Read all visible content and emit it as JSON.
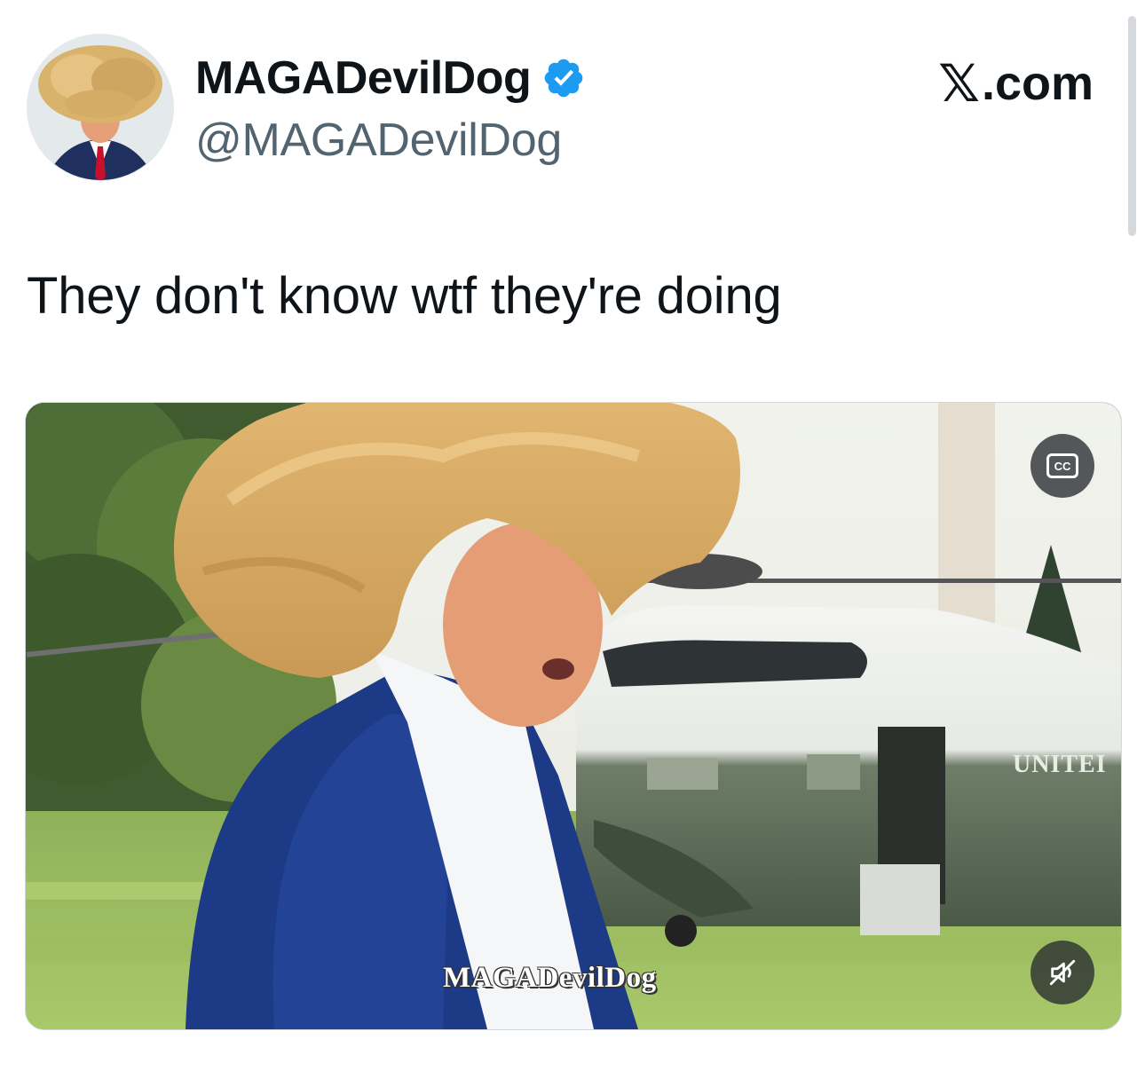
{
  "header": {
    "display_name": "MAGADevilDog",
    "handle": "@MAGADevilDog",
    "brand": ".com",
    "brand_glyph": "𝕏",
    "verified_color": "#1d9bf0"
  },
  "tweet": {
    "text": "They don't know wtf they're doing"
  },
  "media": {
    "watermark": "MAGADevilDog",
    "helicopter_text": "UNITEI",
    "cc_label": "CC",
    "cc_icon": "closed-captions-icon",
    "mute_icon": "volume-muted-icon"
  }
}
